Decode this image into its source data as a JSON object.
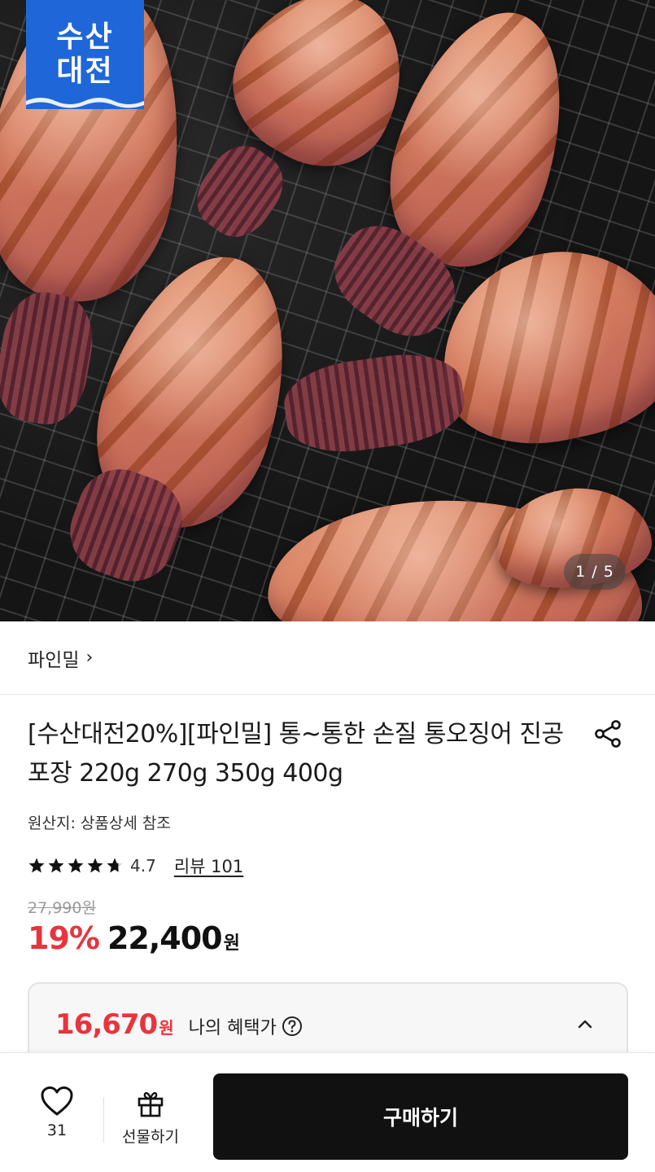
{
  "hero": {
    "logo_line1": "수산",
    "logo_line2": "대전",
    "page_indicator": "1 / 5",
    "current_image": 1,
    "total_images": 5
  },
  "brand": {
    "name": "파인밀",
    "chevron": "›"
  },
  "product": {
    "title": "[수산대전20%][파인밀] 통~통한 손질 통오징어 진공포장 220g 270g 350g 400g",
    "origin": "원산지: 상품상세 참조",
    "rating_value": "4.7",
    "rating_numeric": 4.7,
    "review_link": "리뷰 101",
    "original_price": "27,990원",
    "discount": "19%",
    "sale_price": "22,400",
    "sale_currency": "원"
  },
  "benefit": {
    "price": "16,670",
    "currency": "원",
    "label": "나의 혜택가"
  },
  "bottom_bar": {
    "like_count": "31",
    "gift_label": "선물하기",
    "buy_label": "구매하기"
  },
  "colors": {
    "accent_red": "#e8343c",
    "logo_blue": "#1f67d8",
    "buy_button": "#111111"
  },
  "icons": [
    "share-icon",
    "star-icon",
    "help-icon",
    "chevron-up-icon",
    "heart-icon",
    "gift-icon"
  ]
}
